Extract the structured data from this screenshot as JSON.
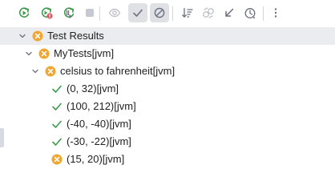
{
  "toolbar": {
    "buttons": [
      {
        "name": "rerun-icon"
      },
      {
        "name": "rerun-failed-icon"
      },
      {
        "name": "toggle-auto-test-icon"
      },
      {
        "name": "stop-icon"
      },
      {
        "name": "show-ignored-eye-icon"
      },
      {
        "name": "show-passed-check-icon",
        "toggled": true
      },
      {
        "name": "show-ignored-circle-slash-icon",
        "toggled": true
      },
      {
        "name": "sort-icon"
      },
      {
        "name": "sort-by-duration-icon"
      },
      {
        "name": "import-tests-icon"
      },
      {
        "name": "test-history-icon"
      },
      {
        "name": "more-options-icon"
      }
    ]
  },
  "tree": {
    "root": {
      "label": "Test Results",
      "status": "failed",
      "expanded": true
    },
    "suite": {
      "label": "MyTests[jvm]",
      "status": "failed",
      "expanded": true
    },
    "group": {
      "label": "celsius to fahrenheit[jvm]",
      "status": "failed",
      "expanded": true
    },
    "tests": [
      {
        "label": "(0, 32)[jvm]",
        "status": "passed"
      },
      {
        "label": "(100, 212)[jvm]",
        "status": "passed"
      },
      {
        "label": "(-40, -40)[jvm]",
        "status": "passed"
      },
      {
        "label": "(-30, -22)[jvm]",
        "status": "passed"
      },
      {
        "label": "(15, 20)[jvm]",
        "status": "failed"
      }
    ]
  },
  "colors": {
    "passed": "#3f9a4c",
    "failed": "#f0a732",
    "rerun": "#3f9a4c",
    "error_badge": "#e55765",
    "icon_gray": "#6c707e",
    "icon_disabled": "#b4b8bf",
    "selection": "#eaecef",
    "toggled_bg": "#dfe1e5"
  }
}
